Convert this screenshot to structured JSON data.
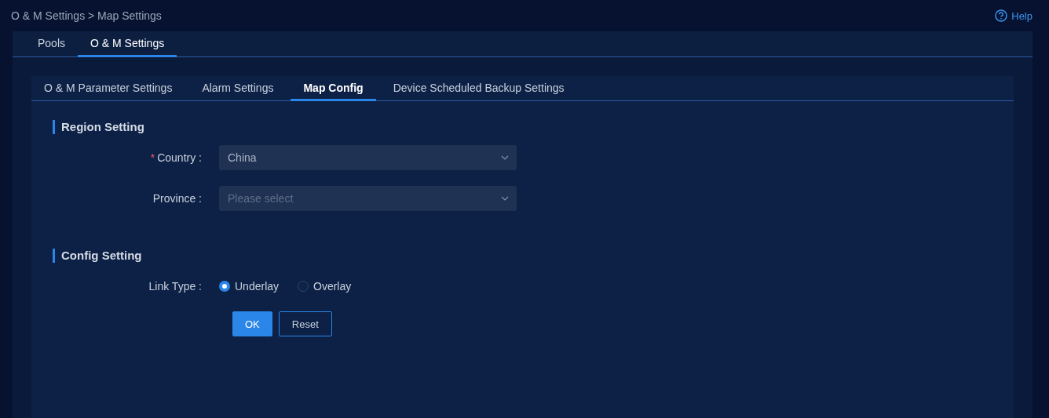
{
  "breadcrumb": "O & M Settings > Map Settings",
  "help": {
    "label": "Help"
  },
  "tabs": [
    {
      "label": "Pools",
      "selected": false
    },
    {
      "label": "O & M Settings",
      "selected": true
    }
  ],
  "subtabs": [
    {
      "label": "O & M Parameter Settings",
      "selected": false
    },
    {
      "label": "Alarm Settings",
      "selected": false
    },
    {
      "label": "Map Config",
      "selected": true
    },
    {
      "label": "Device Scheduled Backup Settings",
      "selected": false
    }
  ],
  "sections": [
    {
      "title": "Region Setting",
      "fields": [
        {
          "kind": "select",
          "label": "Country :",
          "required_mark": "*",
          "value": "China"
        },
        {
          "kind": "select",
          "label": "Province :",
          "placeholder": "Please select"
        }
      ]
    },
    {
      "title": "Config Setting",
      "fields": [
        {
          "kind": "radio",
          "label": "Link Type :",
          "options": [
            {
              "label": "Underlay",
              "selected": true
            },
            {
              "label": "Overlay",
              "selected": false
            }
          ]
        }
      ]
    }
  ],
  "buttons": [
    {
      "label": "OK",
      "kind": "primary"
    },
    {
      "label": "Reset",
      "kind": "secondary"
    }
  ]
}
